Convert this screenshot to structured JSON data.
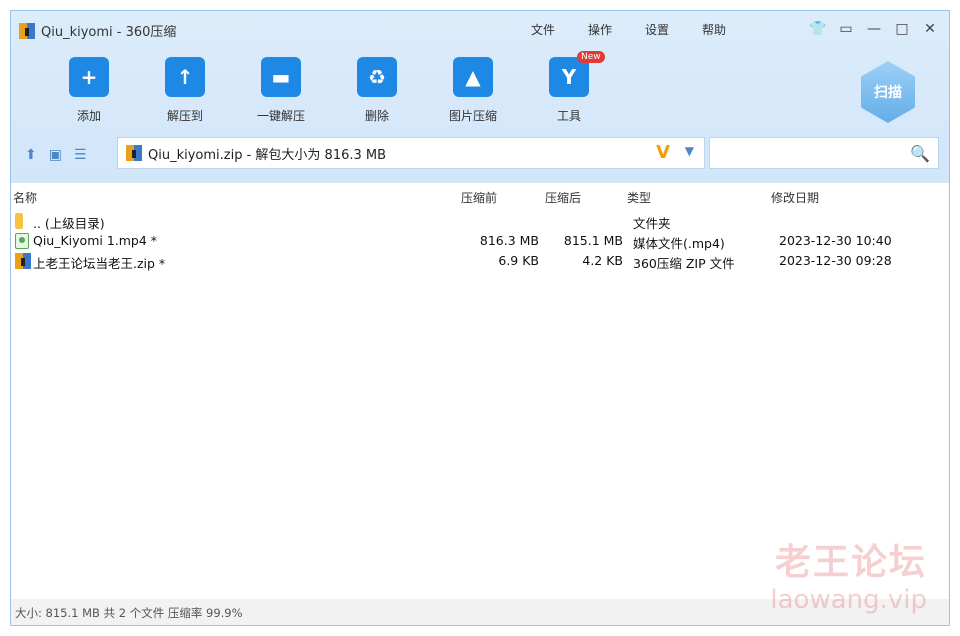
{
  "window": {
    "title": "Qiu_kiyomi - 360压缩",
    "menu": [
      "文件",
      "操作",
      "设置",
      "帮助"
    ],
    "window_buttons": [
      "shirt-icon",
      "feedback-icon",
      "minimize-icon",
      "maximize-icon",
      "close-icon"
    ]
  },
  "toolbar": {
    "items": [
      {
        "label": "添加",
        "icon": "add-icon"
      },
      {
        "label": "解压到",
        "icon": "extract-to-icon"
      },
      {
        "label": "一键解压",
        "icon": "one-click-extract-icon"
      },
      {
        "label": "删除",
        "icon": "delete-icon"
      },
      {
        "label": "图片压缩",
        "icon": "image-compress-icon"
      },
      {
        "label": "工具",
        "icon": "tools-icon",
        "badge": "New"
      }
    ],
    "scan_label": "扫描"
  },
  "nav": {
    "path_text": "Qiu_kiyomi.zip - 解包大小为 816.3 MB",
    "search_placeholder": ""
  },
  "table": {
    "headers": [
      "名称",
      "压缩前",
      "压缩后",
      "类型",
      "修改日期"
    ],
    "rows": [
      {
        "name": ".. (上级目录)",
        "before": "",
        "after": "",
        "type": "文件夹",
        "date": "",
        "icon": "folder-icon"
      },
      {
        "name": "Qiu_Kiyomi 1.mp4 *",
        "before": "816.3 MB",
        "after": "815.1 MB",
        "type": "媒体文件(.mp4)",
        "date": "2023-12-30 10:40",
        "icon": "video-file-icon"
      },
      {
        "name": "上老王论坛当老王.zip *",
        "before": "6.9 KB",
        "after": "4.2 KB",
        "type": "360压缩 ZIP 文件",
        "date": "2023-12-30 09:28",
        "icon": "zip-file-icon"
      }
    ]
  },
  "status": {
    "text": "大小: 815.1 MB 共 2 个文件 压缩率 99.9%"
  },
  "watermark": {
    "line1": "老王论坛",
    "line2": "laowang.vip"
  },
  "colors": {
    "accent": "#1e88e5",
    "header_bg": "#d8eafb"
  }
}
